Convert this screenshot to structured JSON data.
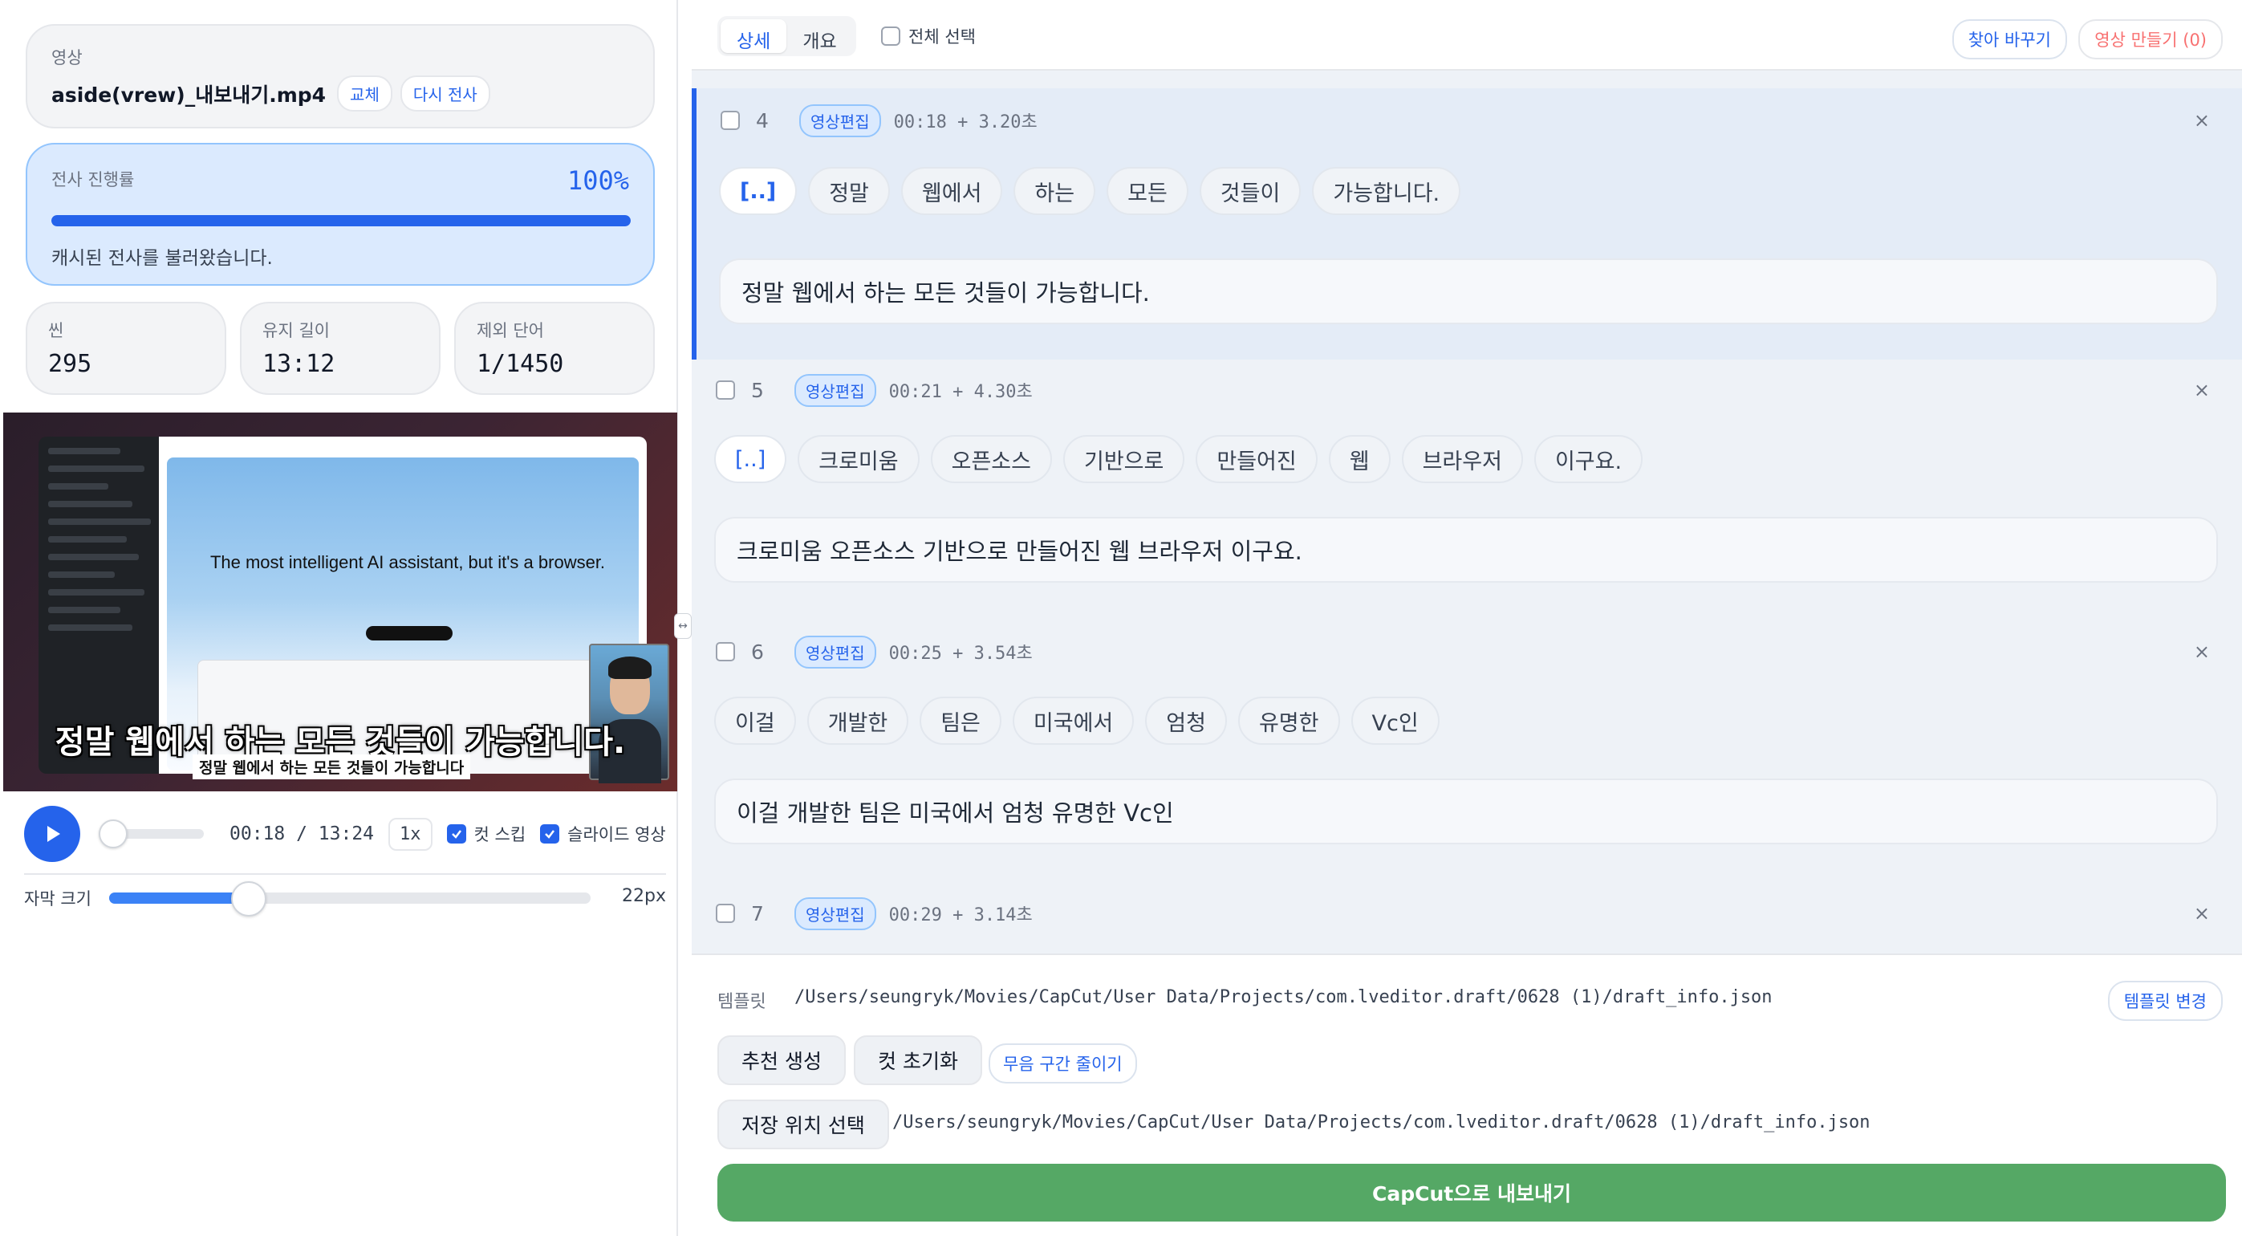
{
  "source": {
    "label": "영상",
    "filename": "aside(vrew)_내보내기.mp4",
    "replace_label": "교체",
    "retranscribe_label": "다시 전사"
  },
  "progress": {
    "label": "전사 진행률",
    "percent_text": "100%",
    "fraction": 1.0,
    "message": "캐시된 전사를 불러왔습니다."
  },
  "stats": {
    "scenes_label": "씬",
    "scenes_value": "295",
    "kept_length_label": "유지 길이",
    "kept_length_value": "13:12",
    "excluded_words_label": "제외 단어",
    "excluded_words_value": "1/1450"
  },
  "preview": {
    "headline": "The most intelligent AI assistant, but it's a browser.",
    "caption_large": "정말 웹에서 하는 모든 것들이 가능합니다.",
    "caption_small": "정말 웹에서 하는 모든 것들이 가능합니다"
  },
  "player": {
    "play_icon": "play-icon",
    "time_text": "00:18 / 13:24",
    "position_fraction": 0.023,
    "speed": "1x",
    "cut_skip_label": "컷 스킵",
    "cut_skip_checked": true,
    "slide_video_label": "슬라이드 영상",
    "slide_video_checked": true
  },
  "font_size": {
    "label": "자막 크기",
    "value_text": "22px",
    "fraction": 0.29
  },
  "toolbar": {
    "tab_detail": "상세",
    "tab_overview": "개요",
    "active_tab": "상세",
    "select_all_label": "전체 선택",
    "find_replace_label": "찾아 바꾸기",
    "make_video_label": "영상 만들기 (0)"
  },
  "scenes": [
    {
      "num": "4",
      "tag": "영상편집",
      "timestamp": "00:18 + 3.20초",
      "words": [
        "[..]",
        "정말",
        "웹에서",
        "하는",
        "모든",
        "것들이",
        "가능합니다."
      ],
      "sentence": "정말 웹에서 하는 모든 것들이 가능합니다."
    },
    {
      "num": "5",
      "tag": "영상편집",
      "timestamp": "00:21 + 4.30초",
      "words": [
        "[..]",
        "크로미움",
        "오픈소스",
        "기반으로",
        "만들어진",
        "웹",
        "브라우저",
        "이구요."
      ],
      "sentence": "크로미움 오픈소스 기반으로 만들어진 웹 브라우저 이구요."
    },
    {
      "num": "6",
      "tag": "영상편집",
      "timestamp": "00:25 + 3.54초",
      "words": [
        "이걸",
        "개발한",
        "팀은",
        "미국에서",
        "엄청",
        "유명한",
        "Vc인"
      ],
      "sentence": "이걸 개발한 팀은 미국에서 엄청 유명한 Vc인"
    },
    {
      "num": "7",
      "tag": "영상편집",
      "timestamp": "00:29 + 3.14초"
    }
  ],
  "export": {
    "template_label": "템플릿",
    "template_path": "/Users/seungryk/Movies/CapCut/User Data/Projects/com.lveditor.draft/0628 (1)/draft_info.json",
    "template_change_label": "템플릿 변경",
    "recommend_label": "추천 생성",
    "reset_cuts_label": "컷 초기화",
    "shrink_silence_label": "무음 구간 줄이기",
    "save_location_label": "저장 위치 선택",
    "save_path": "/Users/seungryk/Movies/CapCut/User Data/Projects/com.lveditor.draft/0628 (1)/draft_info.json",
    "export_label": "CapCut으로 내보내기",
    "export_color": "#55a865"
  },
  "colors": {
    "accent": "#2563eb",
    "progress_bg": "#dbeafe",
    "danger": "#f87171"
  }
}
